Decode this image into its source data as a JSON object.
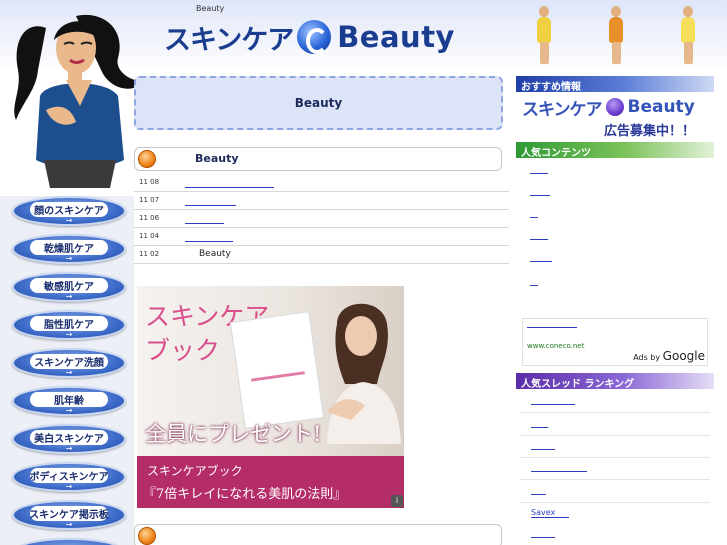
{
  "header": {
    "small_text": "Beauty",
    "logo_jp": "スキンケア",
    "logo_en": "Beauty"
  },
  "nav": {
    "items": [
      {
        "label": "顔のスキンケア"
      },
      {
        "label": "乾燥肌ケア"
      },
      {
        "label": "敏感肌ケア"
      },
      {
        "label": "脂性肌ケア"
      },
      {
        "label": "スキンケア洗顔"
      },
      {
        "label": "肌年齢"
      },
      {
        "label": "美白スキンケア"
      },
      {
        "label": "ボディスキンケア"
      },
      {
        "label": "スキンケア掲示板"
      }
    ],
    "arrow": "→"
  },
  "main": {
    "title": "Beauty",
    "news": {
      "title": "Beauty",
      "rows": [
        {
          "date": "11 08",
          "text": ""
        },
        {
          "date": "11 07",
          "text": ""
        },
        {
          "date": "11 06",
          "text": ""
        },
        {
          "date": "11 04",
          "text": ""
        },
        {
          "date": "11 02",
          "text": "Beauty"
        }
      ]
    },
    "banner": {
      "title_line1": "スキンケア",
      "title_line2": "ブック",
      "present": "全員にプレゼント!",
      "sub1": "スキンケアブック",
      "sub2": "『7倍キレイになれる美肌の法則』",
      "corner": "i"
    }
  },
  "sidebar": {
    "recommended_heading": "おすすめ情報",
    "ad_logo_jp": "スキンケア",
    "ad_logo_en": "Beauty",
    "ad_sub": "広告募集中！！",
    "popular_heading": "人気コンテンツ",
    "google_url": "www.coneco.net",
    "google_ads_prefix": "Ads by",
    "google_ads_brand": "Google",
    "thread_heading": "人気スレッド ランキング",
    "thread_savex": "Savex"
  },
  "colors": {
    "accent_blue": "#1f3fa8",
    "accent_green": "#2e9a35",
    "accent_purple": "#5a2da8",
    "banner_pink": "#b52d68",
    "link_blue": "#2a3fbf"
  }
}
